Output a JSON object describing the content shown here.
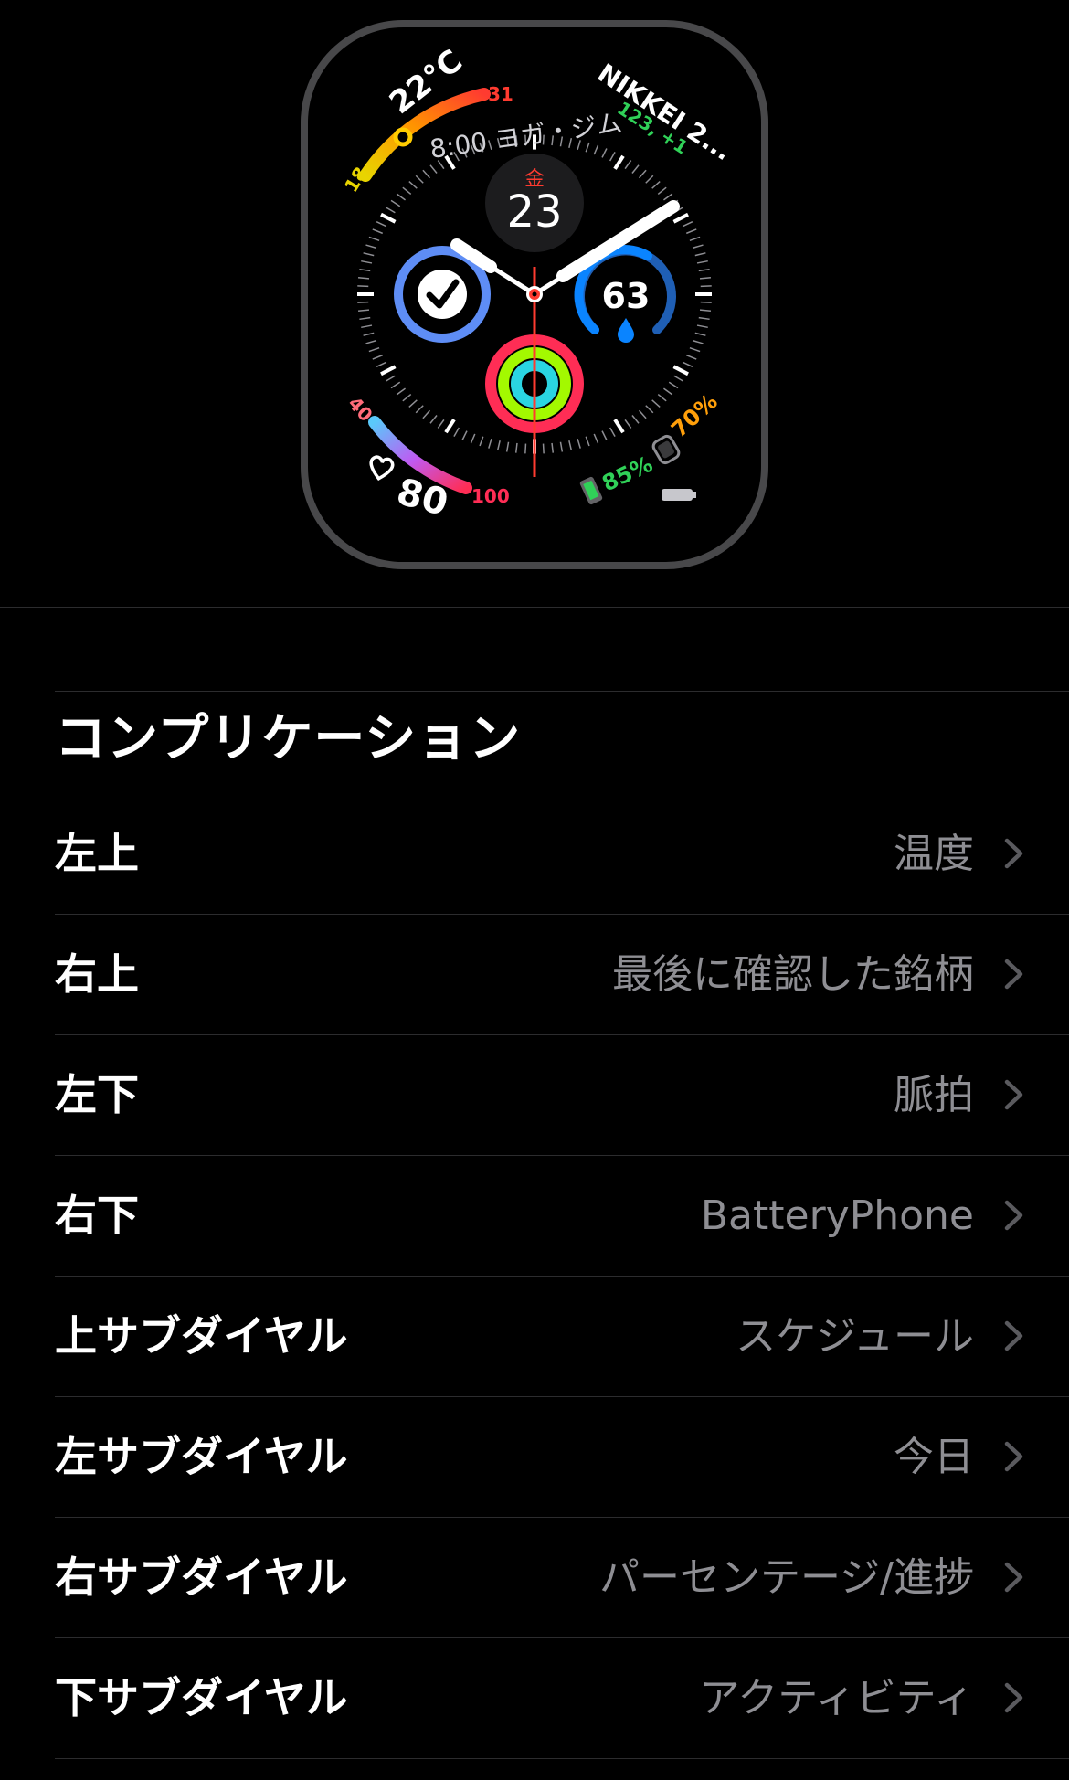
{
  "watch_face": {
    "temperature": "22°C",
    "temp_min": "18",
    "temp_max": "31",
    "schedule": "8:00 ヨガ・ジム",
    "stock_name": "NIKKEI 2...",
    "stock_value": "123, +1",
    "day_of_week": "金",
    "date": "23",
    "humidity": "63",
    "heart_rate": "80",
    "heart_min": "40",
    "heart_max": "100",
    "phone_battery": "85%",
    "watch_battery": "70%"
  },
  "complications": {
    "title": "コンプリケーション",
    "rows": [
      {
        "label": "左上",
        "value": "温度"
      },
      {
        "label": "右上",
        "value": "最後に確認した銘柄"
      },
      {
        "label": "左下",
        "value": "脈拍"
      },
      {
        "label": "右下",
        "value": "BatteryPhone"
      },
      {
        "label": "上サブダイヤル",
        "value": "スケジュール"
      },
      {
        "label": "左サブダイヤル",
        "value": "今日"
      },
      {
        "label": "右サブダイヤル",
        "value": "パーセンテージ/進捗"
      },
      {
        "label": "下サブダイヤル",
        "value": "アクティビティ"
      }
    ]
  },
  "colors": {
    "background": "#000000",
    "value_gray": "#8e8e93",
    "separator": "#2c2c2e",
    "accent_red": "#ff3b30",
    "stock_green": "#30d158",
    "battery_orange": "#ff9f0a"
  }
}
